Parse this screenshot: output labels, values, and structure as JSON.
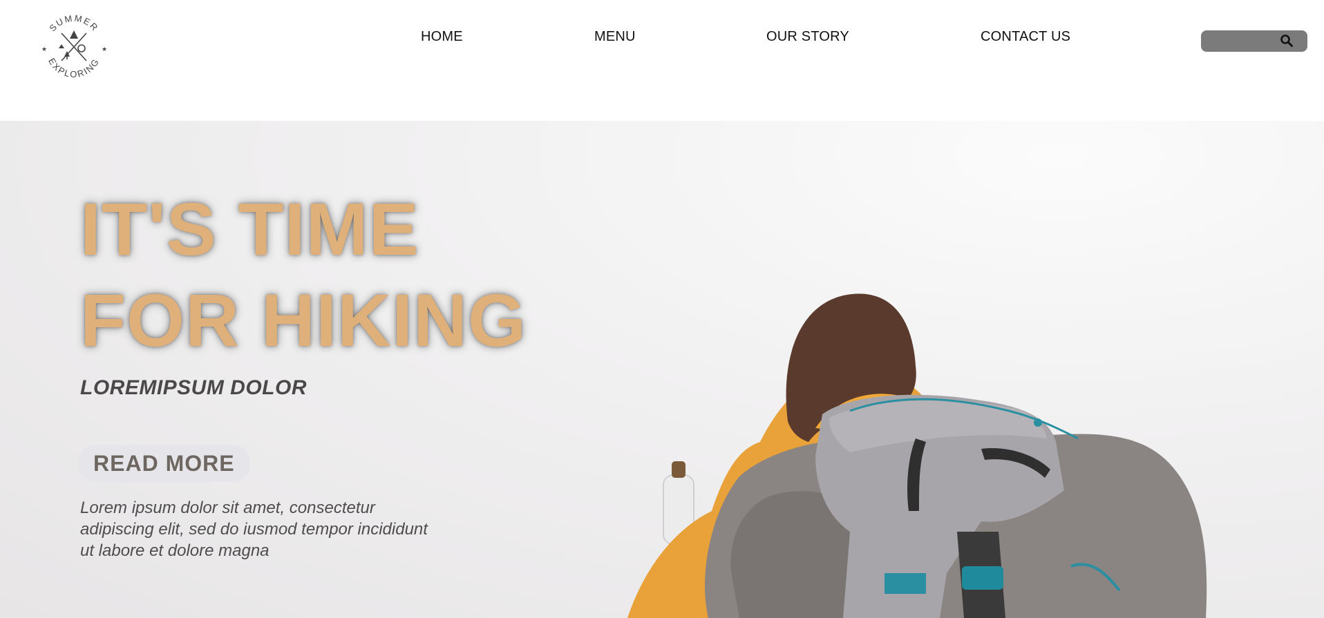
{
  "header": {
    "logo": {
      "text_top": "SUMMER",
      "text_bottom": "EXPLORING",
      "icon": "camping-badge-icon"
    },
    "nav": {
      "home": "HOME",
      "menu": "MENU",
      "story": "OUR STORY",
      "contact": "CONTACT US"
    },
    "search": {
      "placeholder": "",
      "icon": "search-icon"
    }
  },
  "hero": {
    "headline_line1": "IT'S TIME",
    "headline_line2": "FOR HIKING",
    "subheading": "LOREMIPSUM DOLOR",
    "read_more_label": "READ MORE",
    "body": "Lorem ipsum dolor sit amet, consectetur adipiscing elit, sed do iusmod tempor incididunt ut labore et dolore magna",
    "image": "hiker-with-backpack-image"
  },
  "colors": {
    "headline": "#e0b07a",
    "search_bg": "#7b7b7b",
    "button_bg": "#e6e5e9",
    "button_text": "#6d6661",
    "jacket": "#e9a13a",
    "backpack": "#a7a5a9",
    "blanket": "#8a8482",
    "straps": "#2a8fa0"
  }
}
